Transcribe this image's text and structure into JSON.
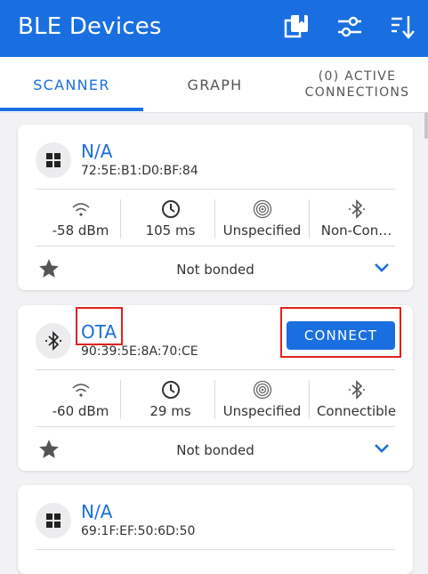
{
  "appbar": {
    "title": "BLE Devices",
    "bg_color": "#1a6fe0",
    "icons": [
      "bookmark-list-icon",
      "filter-sliders-icon",
      "sort-icon"
    ]
  },
  "tabs": [
    {
      "label": "SCANNER",
      "active": true
    },
    {
      "label": "GRAPH",
      "active": false
    },
    {
      "label": "(0) ACTIVE\nCONNECTIONS",
      "active": false
    }
  ],
  "devices": [
    {
      "name": "N/A",
      "address": "72:5E:B1:D0:BF:84",
      "icon": "windows-icon",
      "rssi": "-58 dBm",
      "interval": "105 ms",
      "tx_power": "Unspecified",
      "connectable": "Non-Con…",
      "bond": "Not bonded",
      "show_connect": false
    },
    {
      "name": "OTA",
      "address": "90:39:5E:8A:70:CE",
      "icon": "bluetooth-icon",
      "rssi": "-60 dBm",
      "interval": "29 ms",
      "tx_power": "Unspecified",
      "connectable": "Connectible",
      "bond": "Not bonded",
      "show_connect": true,
      "connect_label": "CONNECT"
    },
    {
      "name": "N/A",
      "address": "69:1F:EF:50:6D:50",
      "icon": "windows-icon"
    }
  ],
  "colors": {
    "accent": "#1a6fe0",
    "highlight": "#e0221e"
  }
}
